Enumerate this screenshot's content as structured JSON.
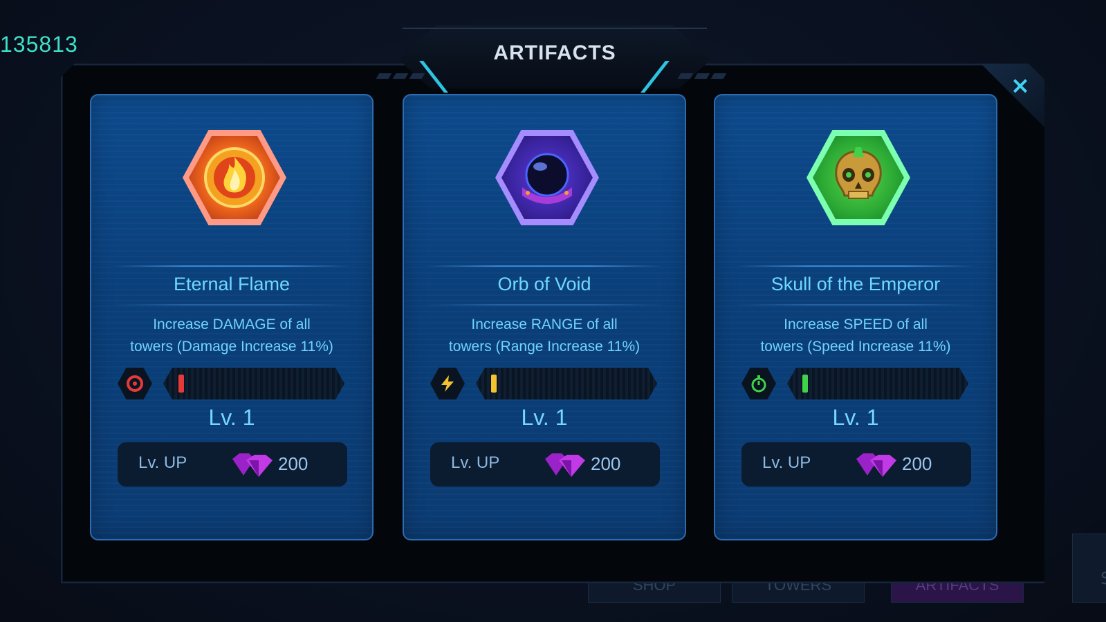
{
  "score": "135813",
  "title": "ARTIFACTS",
  "close_label": "×",
  "bottom_tabs": [
    "SHOP",
    "TOWERS",
    "ARTIFACTS"
  ],
  "right_stub_label": "S",
  "colors": {
    "accent": "#2ec4e0",
    "card_bg": "#0b4080",
    "gem": "#b02cd8"
  },
  "cards": [
    {
      "name": "Eternal Flame",
      "desc_line1": "Increase DAMAGE of all",
      "desc_line2": "towers (Damage Increase 11%)",
      "level": "Lv. 1",
      "progress": 0.02,
      "lvup_label": "Lv. UP",
      "cost": "200",
      "icon": "flame-orb-icon",
      "stat_icon": "target-icon",
      "color": "#e63a3a"
    },
    {
      "name": "Orb of Void",
      "desc_line1": "Increase RANGE of all",
      "desc_line2": "towers (Range Increase 11%)",
      "level": "Lv. 1",
      "progress": 0.02,
      "lvup_label": "Lv. UP",
      "cost": "200",
      "icon": "void-orb-icon",
      "stat_icon": "lightning-icon",
      "color": "#f2c230"
    },
    {
      "name": "Skull of the Emperor",
      "desc_line1": "Increase SPEED of all",
      "desc_line2": "towers (Speed Increase 11%)",
      "level": "Lv. 1",
      "progress": 0.02,
      "lvup_label": "Lv. UP",
      "cost": "200",
      "icon": "golden-skull-icon",
      "stat_icon": "stopwatch-icon",
      "color": "#3fd24a"
    }
  ]
}
